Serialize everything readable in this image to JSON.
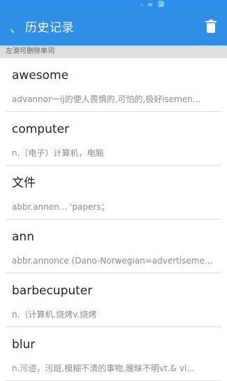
{
  "status_overlay": "- ≈ 录",
  "app_bar": {
    "back_glyph": "、",
    "title": "历史记录",
    "delete_icon": "trash-icon"
  },
  "hint": "左滑可删除单词",
  "items": [
    {
      "word": "awesome",
      "meaning": "advannor一ij的使人畏惧的,可怕的,极好isemen..."
    },
    {
      "word": "computer",
      "meaning": "n.（电子）计算机，电脑"
    },
    {
      "word": "文件",
      "meaning": "abbr.annen... 'papers；"
    },
    {
      "word": "ann",
      "meaning": "abbr.annonce (Dano-Norwegian=advertisemen..."
    },
    {
      "word": "barbecuputer",
      "meaning": "n.（计算机.烧烤v.烧烤"
    },
    {
      "word": "blur",
      "meaning": "n.污迹，污斑,模糊不清的事物,暧昧不明vt.& vi..."
    }
  ],
  "colors": {
    "app_bar": "#2f8fe6",
    "hint_bar": "#dedede",
    "divider": "#dcdcdc"
  }
}
